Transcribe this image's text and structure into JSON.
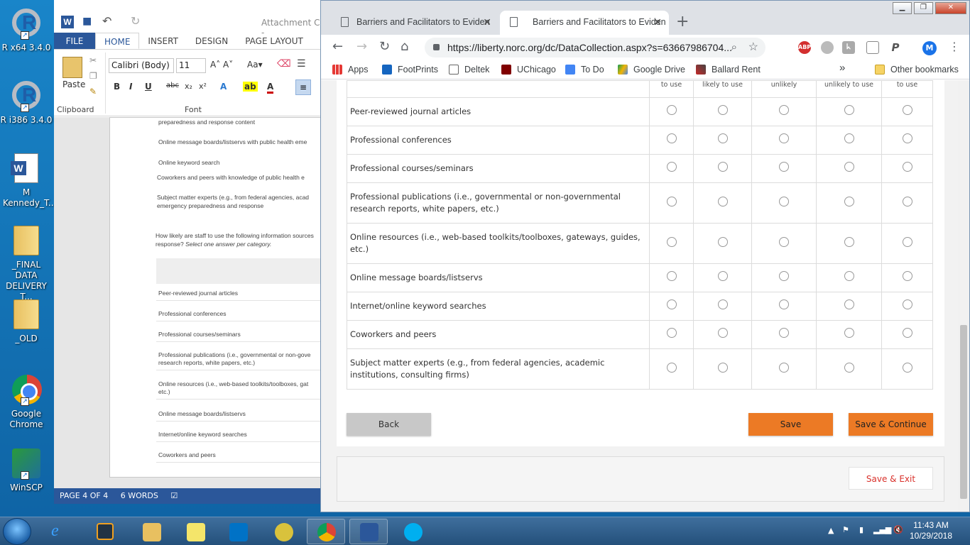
{
  "desktop": {
    "icons": [
      {
        "label": "R x64 3.4.0"
      },
      {
        "label": "R i386 3.4.0"
      },
      {
        "label": "M Kennedy_T..."
      },
      {
        "label": "_FINAL DATA DELIVERY T..."
      },
      {
        "label": "_OLD"
      },
      {
        "label": "Google Chrome"
      },
      {
        "label": "WinSCP"
      }
    ]
  },
  "word": {
    "title": "Attachment C -",
    "tabs": [
      "FILE",
      "HOME",
      "INSERT",
      "DESIGN",
      "PAGE LAYOUT"
    ],
    "paste_label": "Paste",
    "clipboard_label": "Clipboard",
    "font_label": "Font",
    "font_name": "Calibri (Body)",
    "font_size": "11",
    "doc_lines": [
      "preparedness and response content",
      "Online message boards/listservs with public health eme",
      "Online keyword search",
      "Coworkers and peers with knowledge of public health e",
      "Subject matter experts (e.g., from federal agencies, acad emergency preparedness and response"
    ],
    "question": "How likely are staff to use the following information sources response?",
    "question_hint": "Select one answer per category.",
    "doc_rows": [
      "Peer-reviewed journal articles",
      "Professional conferences",
      "Professional courses/seminars",
      "Professional publications (i.e., governmental or non-gove research reports, white papers, etc.)",
      "Online resources (i.e., web-based toolkits/toolboxes, gat etc.)",
      "Online message boards/listservs",
      "Internet/online keyword searches",
      "Coworkers and peers"
    ],
    "status_page": "PAGE 4 OF 4",
    "status_words": "6 WORDS"
  },
  "chrome": {
    "tabs": [
      {
        "title": "Barriers and Facilitators to Eviden"
      },
      {
        "title": "Barriers and Facilitators to Eviden"
      }
    ],
    "url": "https://liberty.norc.org/dc/DataCollection.aspx?s=63667986704...",
    "profile_initial": "M",
    "bookmarks": [
      "Apps",
      "FootPrints",
      "Deltek",
      "UChicago",
      "To Do",
      "Google Drive",
      "Ballard Rent"
    ],
    "other_bookmarks": "Other bookmarks",
    "overflow": "»"
  },
  "survey": {
    "column_headers": [
      "to use",
      "likely to use",
      "unlikely",
      "unlikely to use",
      "to use"
    ],
    "rows": [
      "Peer-reviewed journal articles",
      "Professional conferences",
      "Professional courses/seminars",
      "Professional publications (i.e., governmental or non-governmental research reports, white papers, etc.)",
      "Online resources (i.e., web-based toolkits/toolboxes, gateways, guides, etc.)",
      "Online message boards/listservs",
      "Internet/online keyword searches",
      "Coworkers and peers",
      "Subject matter experts (e.g., from federal agencies, academic institutions, consulting firms)"
    ],
    "back_label": "Back",
    "save_label": "Save",
    "save_continue_label": "Save & Continue",
    "save_exit_label": "Save & Exit",
    "accent_color": "#ec7a25"
  },
  "taskbar": {
    "time": "11:43 AM",
    "date": "10/29/2018"
  }
}
